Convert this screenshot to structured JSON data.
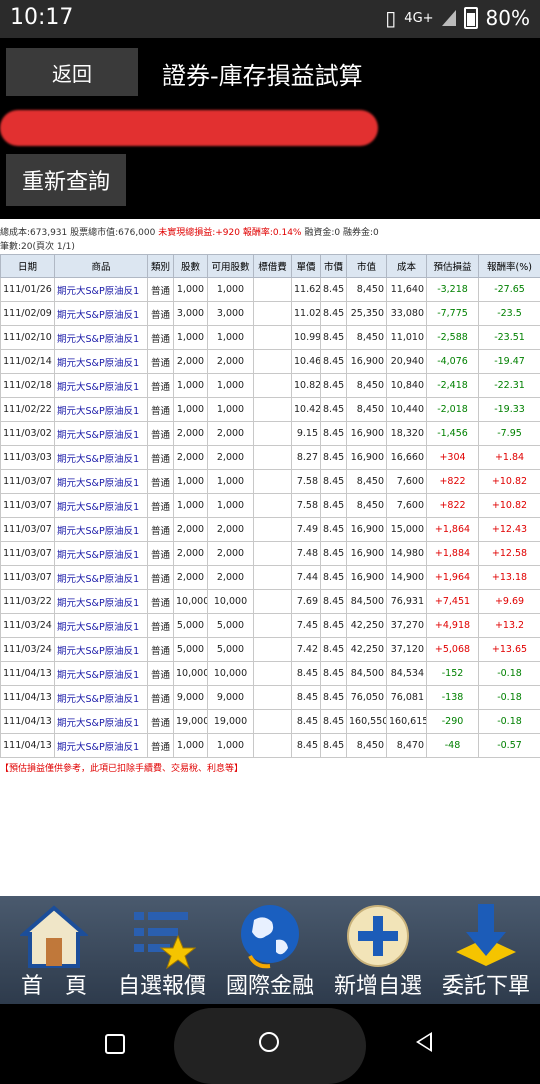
{
  "status": {
    "time": "10:17",
    "network": "4G+",
    "battery": "80%"
  },
  "header": {
    "back_label": "返回",
    "title": "證券-庫存損益試算",
    "requery_label": "重新查詢"
  },
  "summary": {
    "line1_prefix": "總成本:673,931 股票總市值:676,000 ",
    "line1_red": "未實現總損益:+920 報酬率:0.14%",
    "line1_suffix": " 融資金:0 融券金:0",
    "line2": "筆數:20(頁次 1/1)"
  },
  "table": {
    "columns": [
      "日期",
      "商品",
      "類別",
      "股數",
      "可用股數",
      "標借費",
      "單價",
      "市價",
      "市值",
      "成本",
      "預估損益",
      "報酬率(%)"
    ],
    "rows": [
      [
        "111/01/26",
        "期元大S&P原油反1",
        "普通",
        "1,000",
        "1,000",
        "",
        "11.62",
        "8.45",
        "8,450",
        "11,640",
        "-3,218",
        "-27.65"
      ],
      [
        "111/02/09",
        "期元大S&P原油反1",
        "普通",
        "3,000",
        "3,000",
        "",
        "11.02",
        "8.45",
        "25,350",
        "33,080",
        "-7,775",
        "-23.5"
      ],
      [
        "111/02/10",
        "期元大S&P原油反1",
        "普通",
        "1,000",
        "1,000",
        "",
        "10.99",
        "8.45",
        "8,450",
        "11,010",
        "-2,588",
        "-23.51"
      ],
      [
        "111/02/14",
        "期元大S&P原油反1",
        "普通",
        "2,000",
        "2,000",
        "",
        "10.46",
        "8.45",
        "16,900",
        "20,940",
        "-4,076",
        "-19.47"
      ],
      [
        "111/02/18",
        "期元大S&P原油反1",
        "普通",
        "1,000",
        "1,000",
        "",
        "10.82",
        "8.45",
        "8,450",
        "10,840",
        "-2,418",
        "-22.31"
      ],
      [
        "111/02/22",
        "期元大S&P原油反1",
        "普通",
        "1,000",
        "1,000",
        "",
        "10.42",
        "8.45",
        "8,450",
        "10,440",
        "-2,018",
        "-19.33"
      ],
      [
        "111/03/02",
        "期元大S&P原油反1",
        "普通",
        "2,000",
        "2,000",
        "",
        "9.15",
        "8.45",
        "16,900",
        "18,320",
        "-1,456",
        "-7.95"
      ],
      [
        "111/03/03",
        "期元大S&P原油反1",
        "普通",
        "2,000",
        "2,000",
        "",
        "8.27",
        "8.45",
        "16,900",
        "16,660",
        "+304",
        "+1.84"
      ],
      [
        "111/03/07",
        "期元大S&P原油反1",
        "普通",
        "1,000",
        "1,000",
        "",
        "7.58",
        "8.45",
        "8,450",
        "7,600",
        "+822",
        "+10.82"
      ],
      [
        "111/03/07",
        "期元大S&P原油反1",
        "普通",
        "1,000",
        "1,000",
        "",
        "7.58",
        "8.45",
        "8,450",
        "7,600",
        "+822",
        "+10.82"
      ],
      [
        "111/03/07",
        "期元大S&P原油反1",
        "普通",
        "2,000",
        "2,000",
        "",
        "7.49",
        "8.45",
        "16,900",
        "15,000",
        "+1,864",
        "+12.43"
      ],
      [
        "111/03/07",
        "期元大S&P原油反1",
        "普通",
        "2,000",
        "2,000",
        "",
        "7.48",
        "8.45",
        "16,900",
        "14,980",
        "+1,884",
        "+12.58"
      ],
      [
        "111/03/07",
        "期元大S&P原油反1",
        "普通",
        "2,000",
        "2,000",
        "",
        "7.44",
        "8.45",
        "16,900",
        "14,900",
        "+1,964",
        "+13.18"
      ],
      [
        "111/03/22",
        "期元大S&P原油反1",
        "普通",
        "10,000",
        "10,000",
        "",
        "7.69",
        "8.45",
        "84,500",
        "76,931",
        "+7,451",
        "+9.69"
      ],
      [
        "111/03/24",
        "期元大S&P原油反1",
        "普通",
        "5,000",
        "5,000",
        "",
        "7.45",
        "8.45",
        "42,250",
        "37,270",
        "+4,918",
        "+13.2"
      ],
      [
        "111/03/24",
        "期元大S&P原油反1",
        "普通",
        "5,000",
        "5,000",
        "",
        "7.42",
        "8.45",
        "42,250",
        "37,120",
        "+5,068",
        "+13.65"
      ],
      [
        "111/04/13",
        "期元大S&P原油反1",
        "普通",
        "10,000",
        "10,000",
        "",
        "8.45",
        "8.45",
        "84,500",
        "84,534",
        "-152",
        "-0.18"
      ],
      [
        "111/04/13",
        "期元大S&P原油反1",
        "普通",
        "9,000",
        "9,000",
        "",
        "8.45",
        "8.45",
        "76,050",
        "76,081",
        "-138",
        "-0.18"
      ],
      [
        "111/04/13",
        "期元大S&P原油反1",
        "普通",
        "19,000",
        "19,000",
        "",
        "8.45",
        "8.45",
        "160,550",
        "160,615",
        "-290",
        "-0.18"
      ],
      [
        "111/04/13",
        "期元大S&P原油反1",
        "普通",
        "1,000",
        "1,000",
        "",
        "8.45",
        "8.45",
        "8,450",
        "8,470",
        "-48",
        "-0.57"
      ]
    ]
  },
  "note": "【預估損益僅供參考，此項已扣除手續費、交易稅、利息等】",
  "bottom_nav": [
    {
      "label": "首　頁",
      "icon": "home-icon"
    },
    {
      "label": "自選報價",
      "icon": "watchlist-icon"
    },
    {
      "label": "國際金融",
      "icon": "globe-icon"
    },
    {
      "label": "新增自選",
      "icon": "add-icon"
    },
    {
      "label": "委託下單",
      "icon": "order-icon"
    }
  ],
  "colors": {
    "gain": "#e00000",
    "loss": "#008000",
    "header_bg": "#dce6f1"
  }
}
